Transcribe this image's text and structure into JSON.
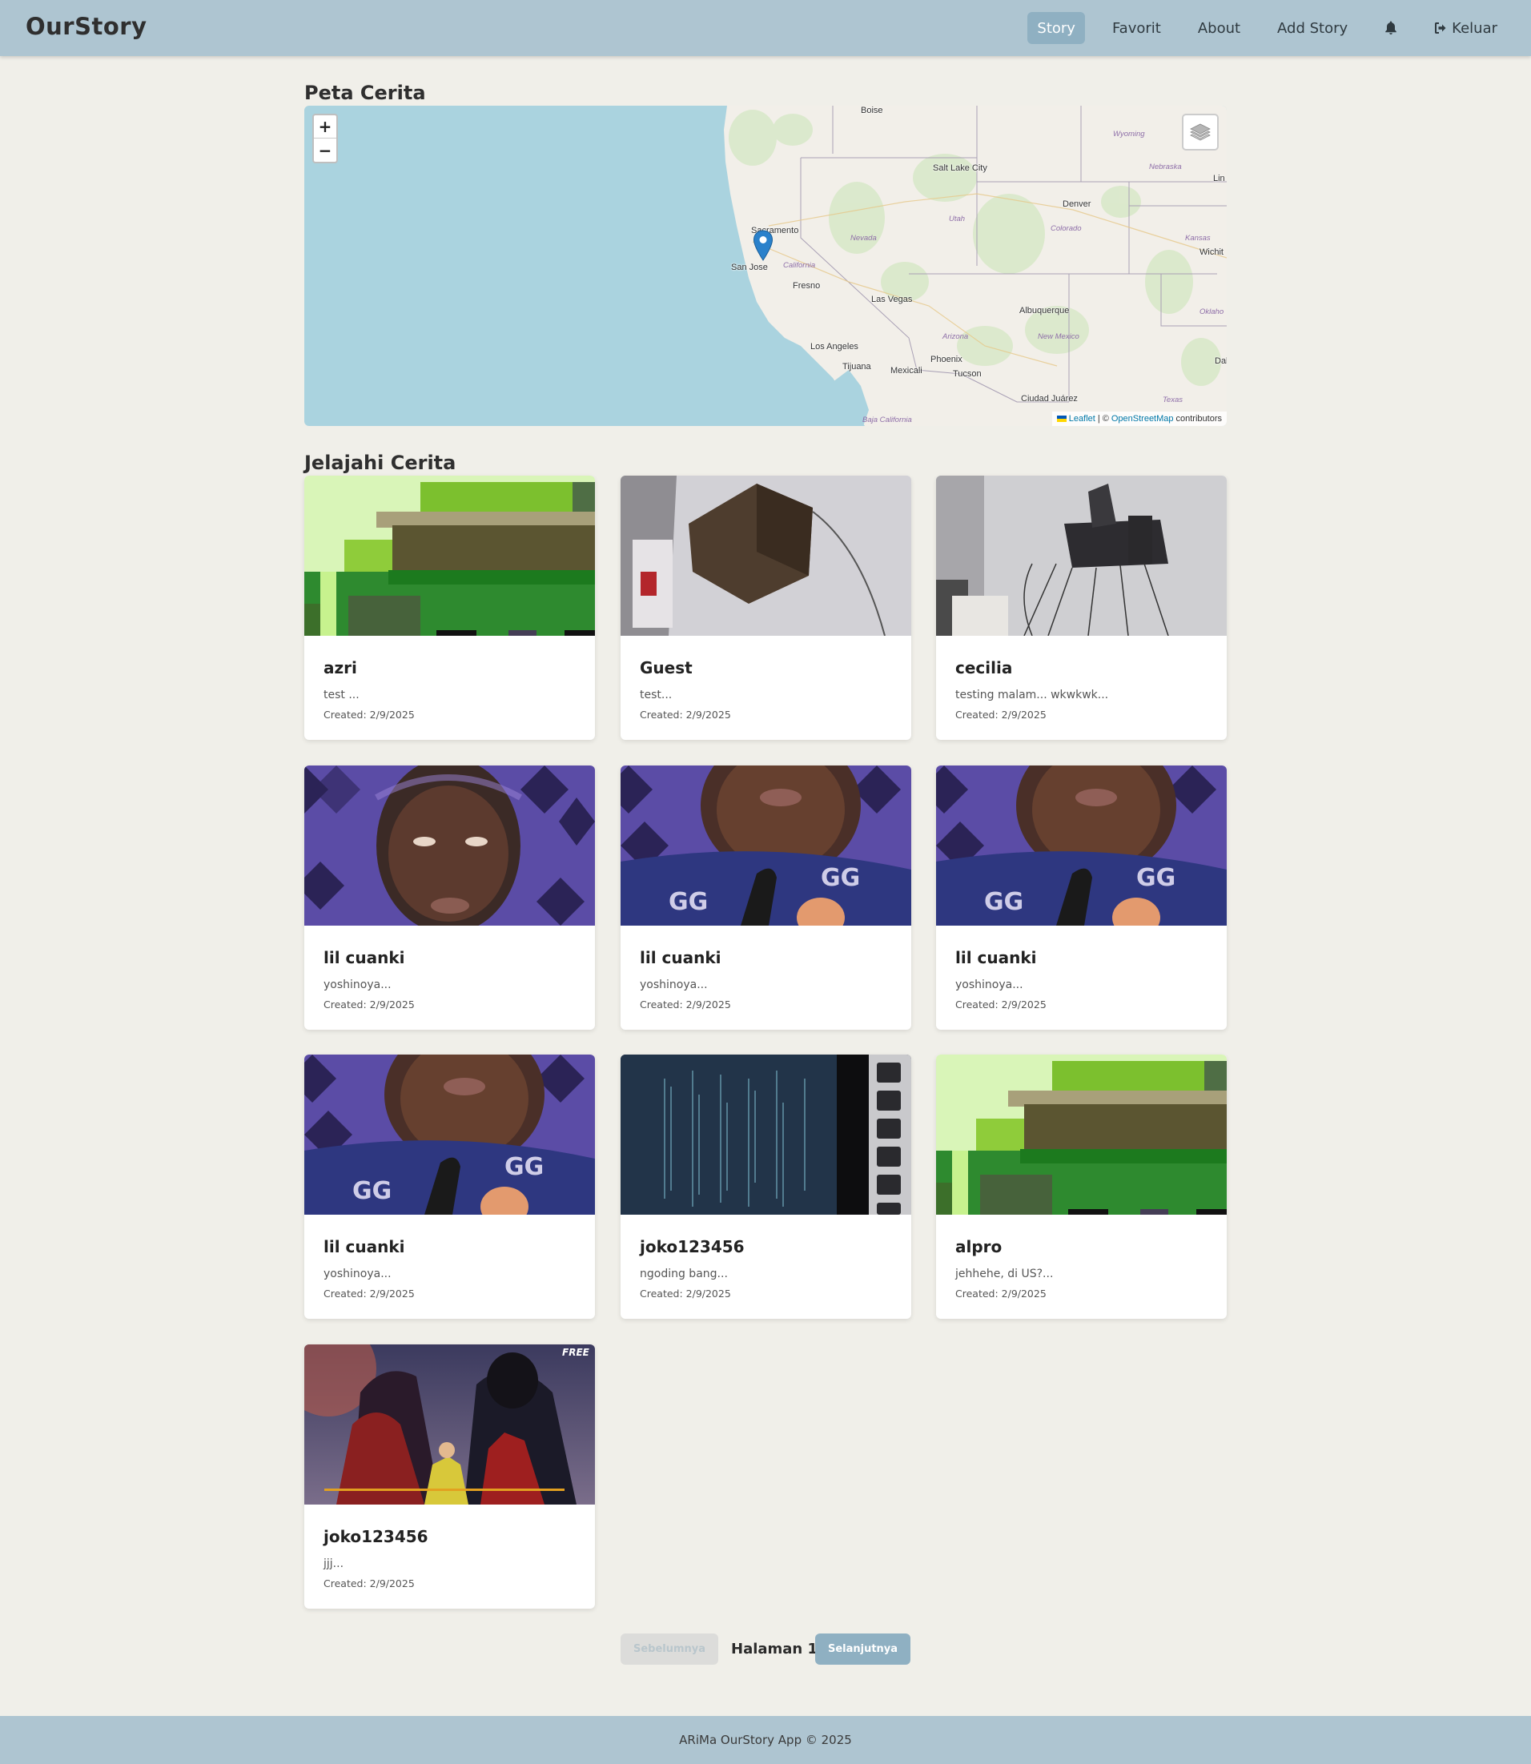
{
  "header": {
    "brand": "OurStory",
    "nav": [
      {
        "label": "Story",
        "active": true
      },
      {
        "label": "Favorit"
      },
      {
        "label": "About"
      },
      {
        "label": "Add Story"
      }
    ],
    "bell_icon": "bell-icon",
    "logout": {
      "icon": "sign-out-icon",
      "label": "Keluar"
    }
  },
  "map_section": {
    "title": "Peta Cerita",
    "zoom_in": "+",
    "zoom_out": "−",
    "layers_icon": "layers-icon",
    "marker_icon": "map-marker-icon",
    "attribution": {
      "leaflet": "Leaflet",
      "separator": "| ©",
      "osm": "OpenStreetMap",
      "suffix": "contributors"
    },
    "cities": [
      "Boise",
      "Salt Lake City",
      "Denver",
      "Sacramento",
      "San Jose",
      "Fresno",
      "Las Vegas",
      "Albuquerque",
      "Los Angeles",
      "Phoenix",
      "Tijuana",
      "Mexicali",
      "Tucson",
      "Ciudad Juárez",
      "Wichit",
      "Dal",
      "Lin"
    ],
    "states": [
      "Wyoming",
      "Nebraska",
      "Utah",
      "Colorado",
      "Nevada",
      "Kansas",
      "California",
      "Arizona",
      "New Mexico",
      "Oklaho",
      "Texas",
      "Baja California"
    ]
  },
  "stories_section": {
    "title": "Jelajahi Cerita",
    "stories": [
      {
        "name": "azri",
        "desc": "test ...",
        "date": "Created: 2/9/2025"
      },
      {
        "name": "Guest",
        "desc": "test...",
        "date": "Created: 2/9/2025"
      },
      {
        "name": "cecilia",
        "desc": "testing malam... wkwkwk...",
        "date": "Created: 2/9/2025"
      },
      {
        "name": "lil cuanki",
        "desc": "yoshinoya...",
        "date": "Created: 2/9/2025"
      },
      {
        "name": "lil cuanki",
        "desc": "yoshinoya...",
        "date": "Created: 2/9/2025"
      },
      {
        "name": "lil cuanki",
        "desc": "yoshinoya...",
        "date": "Created: 2/9/2025"
      },
      {
        "name": "lil cuanki",
        "desc": "yoshinoya...",
        "date": "Created: 2/9/2025"
      },
      {
        "name": "joko123456",
        "desc": "ngoding bang...",
        "date": "Created: 2/9/2025"
      },
      {
        "name": "alpro",
        "desc": "jehhehe, di US?...",
        "date": "Created: 2/9/2025"
      },
      {
        "name": "joko123456",
        "desc": "jjj...",
        "date": "Created: 2/9/2025"
      }
    ]
  },
  "pagination": {
    "prev": "Sebelumnya",
    "page": "Halaman 1",
    "next": "Selanjutnya"
  },
  "footer": {
    "text": "ARiMa OurStory App © 2025"
  },
  "colors": {
    "header": "#aec5d1",
    "accent": "#8fb0c2",
    "background": "#f0efe9"
  }
}
